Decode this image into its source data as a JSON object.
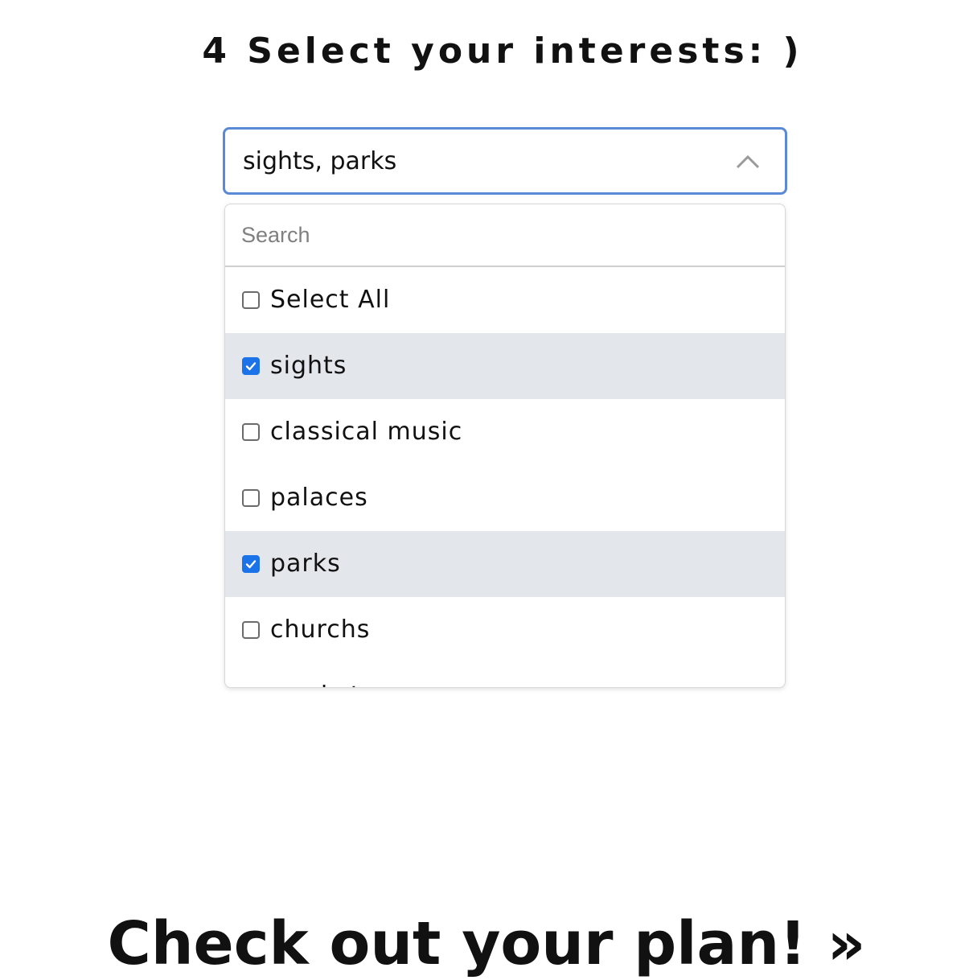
{
  "header": {
    "title": "4 Select your interests: )"
  },
  "select": {
    "value": "sights, parks",
    "expanded": true
  },
  "dropdown": {
    "search_placeholder": "Search",
    "search_value": "",
    "options": [
      {
        "label": "Select All",
        "checked": false
      },
      {
        "label": "sights",
        "checked": true
      },
      {
        "label": "classical music",
        "checked": false
      },
      {
        "label": "palaces",
        "checked": false
      },
      {
        "label": "parks",
        "checked": true
      },
      {
        "label": "churchs",
        "checked": false
      },
      {
        "label": "markets",
        "checked": false
      }
    ]
  },
  "cta": {
    "label": "Check out your plan! »"
  },
  "colors": {
    "focus_border": "#5a8ad6",
    "checkbox_checked": "#1a73e8",
    "selected_row_bg": "#e3e6eb"
  },
  "icons": {
    "select_toggle": "chevron-up-icon",
    "checkmark": "checkmark-icon"
  }
}
